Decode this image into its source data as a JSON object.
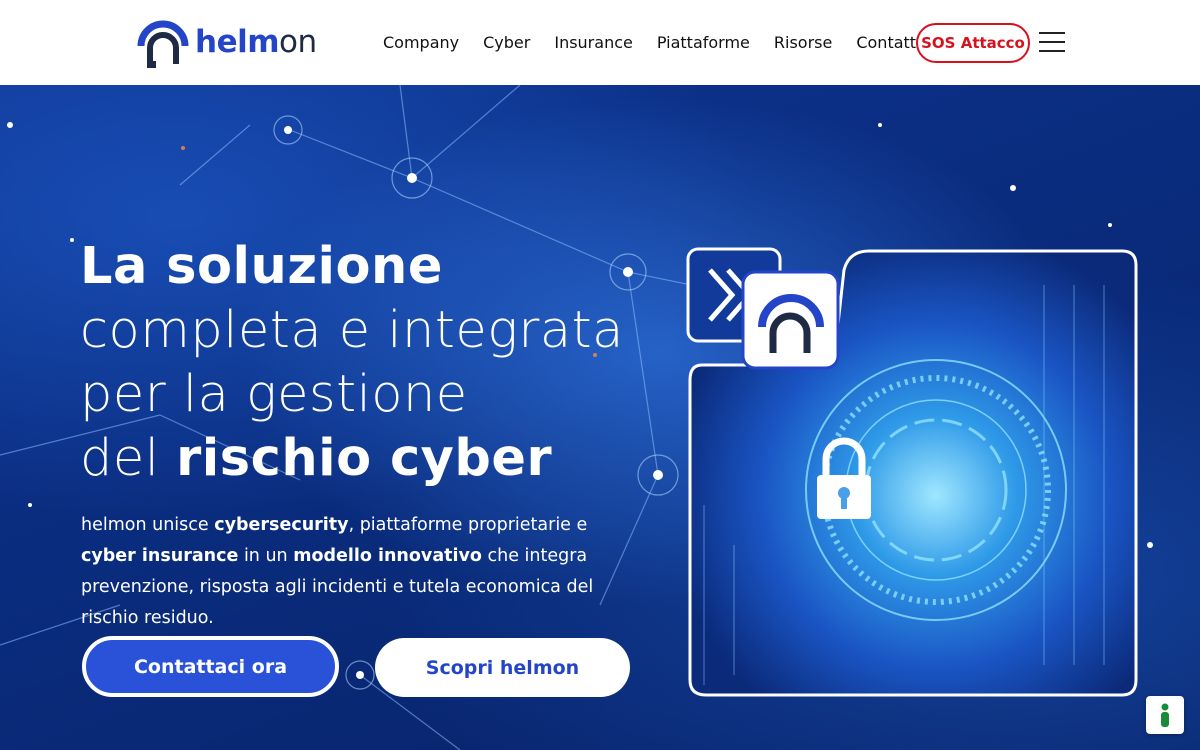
{
  "brand": {
    "logo_bold": "helm",
    "logo_regular": "on",
    "primary_color": "#2545c9",
    "sos_color": "#d9101d"
  },
  "nav": {
    "items": [
      {
        "label": "Company"
      },
      {
        "label": "Cyber"
      },
      {
        "label": "Insurance"
      },
      {
        "label": "Piattaforme"
      },
      {
        "label": "Risorse"
      },
      {
        "label": "Contatti"
      }
    ],
    "sos_label": "SOS Attacco",
    "menu_icon": "hamburger-icon"
  },
  "hero": {
    "line1": "La soluzione",
    "line2": "completa e integrata",
    "line3": "per la gestione",
    "line4_regular": "del ",
    "line4_bold": "rischio cyber",
    "desc": {
      "p1": "helmon unisce ",
      "b1": "cybersecurity",
      "p2": ", piattaforme proprietarie e ",
      "b2": "cyber insurance",
      "p3": " in un ",
      "b3": "modello innovativo",
      "p4": " che integra prevenzione, risposta agli incidenti e tutela economica del rischio residuo."
    },
    "cta_primary": "Contattaci ora",
    "cta_secondary": "Scopri helmon",
    "illustration_icons": [
      "double-chevron-icon",
      "helmon-logo-icon",
      "padlock-icon"
    ]
  },
  "floating_widget": {
    "icon": "accessibility-person-icon",
    "color": "#1a8a3a"
  }
}
